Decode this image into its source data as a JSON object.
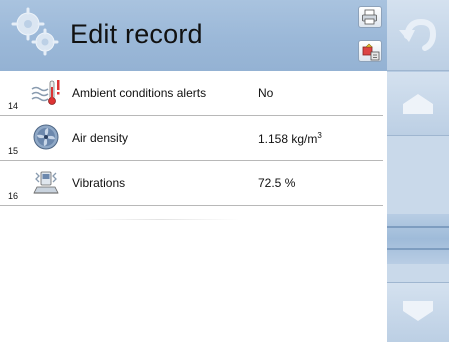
{
  "header": {
    "title": "Edit record",
    "icons": {
      "logo": "gears-icon",
      "print": "printer-icon",
      "export": "export-icon"
    }
  },
  "rows": [
    {
      "number": "14",
      "icon": "thermometer-alert-icon",
      "label": "Ambient conditions alerts",
      "value": "No"
    },
    {
      "number": "15",
      "icon": "fan-icon",
      "label": "Air density",
      "value": "1.158 kg/m",
      "value_sup": "3"
    },
    {
      "number": "16",
      "icon": "vibration-icon",
      "label": "Vibrations",
      "value": "72.5 %"
    }
  ],
  "sidebar": {
    "back_icon": "undo-arrow-icon",
    "up_icon": "scroll-up-icon",
    "down_icon": "scroll-down-icon"
  },
  "colors": {
    "header": "#9bb8d8",
    "panel": "#b6cbe2"
  }
}
